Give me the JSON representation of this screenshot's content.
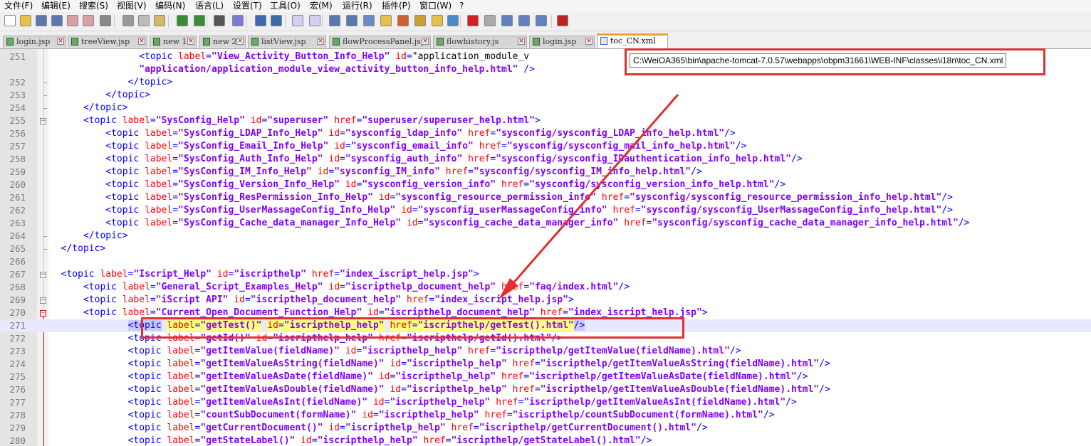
{
  "menu": [
    "文件(F)",
    "编辑(E)",
    "搜索(S)",
    "视图(V)",
    "编码(N)",
    "语言(L)",
    "设置(T)",
    "工具(O)",
    "宏(M)",
    "运行(R)",
    "插件(P)",
    "窗口(W)",
    "?"
  ],
  "tabs": [
    "login.jsp",
    "treeView.jsp",
    "new 1",
    "new 2",
    "listView.jsp",
    "flowProcessPanel.jsp",
    "flowhistory.js",
    "login.jsp",
    "toc_CN.xml"
  ],
  "tooltip": "C:\\WeiOA365\\bin\\apache-tomcat-7.0.57\\webapps\\obpm31661\\WEB-INF\\classes\\i18n\\toc_CN.xml",
  "toolbar_icons": [
    "new-file-icon",
    "open-icon",
    "save-icon",
    "save-all-icon",
    "close-icon",
    "close-all-icon",
    "print-icon",
    "cut-icon",
    "copy-icon",
    "paste-icon",
    "undo-icon",
    "redo-icon",
    "find-icon",
    "replace-icon",
    "zoom-in-icon",
    "zoom-out-icon",
    "sync-v-icon",
    "sync-h-icon",
    "word-wrap-icon",
    "show-all-chars-icon",
    "indent-guide-icon",
    "lang-icon",
    "doc-map-icon",
    "function-list-icon",
    "folder-icon",
    "monitor-icon",
    "record-macro-icon",
    "stop-macro-icon",
    "play-macro-icon",
    "run-macro-multiple-icon",
    "save-macro-icon",
    "spellcheck-icon"
  ],
  "lines": [
    {
      "n": "251",
      "code": "                <topic label=\"View_Activity_Button_Info_Help\" id=\"application_module_v"
    },
    {
      "n": "",
      "code": "                \"application/application_module_view_activity_button_info_help.html\" />"
    },
    {
      "n": "252",
      "code": "              </topic>"
    },
    {
      "n": "253",
      "code": "          </topic>"
    },
    {
      "n": "254",
      "code": "      </topic>"
    },
    {
      "n": "255",
      "code": "      <topic label=\"SysConfig_Help\" id=\"superuser\" href=\"superuser/superuser_help.html\">"
    },
    {
      "n": "256",
      "code": "          <topic label=\"SysConfig_LDAP_Info_Help\" id=\"sysconfig_ldap_info\" href=\"sysconfig/sysconfig_LDAP_info_help.html\"/>"
    },
    {
      "n": "257",
      "code": "          <topic label=\"SysConfig_Email_Info_Help\" id=\"sysconfig_email_info\" href=\"sysconfig/sysconfig_mail_info_help.html\"/>"
    },
    {
      "n": "258",
      "code": "          <topic label=\"SysConfig_Auth_Info_Help\" id=\"sysconfig_auth_info\" href=\"sysconfig/sysconfig_IDauthentication_info_help.html\"/>"
    },
    {
      "n": "259",
      "code": "          <topic label=\"SysConfig_IM_Info_Help\" id=\"sysconfig_IM_info\" href=\"sysconfig/sysconfig_IM_info_help.html\"/>"
    },
    {
      "n": "260",
      "code": "          <topic label=\"SysConfig_Version_Info_Help\" id=\"sysconfig_version_info\" href=\"sysconfig/sysconfig_version_info_help.html\"/>"
    },
    {
      "n": "261",
      "code": "          <topic label=\"SysConfig_ResPermission_Info_Help\" id=\"sysconfig_resource_permission_info\" href=\"sysconfig/sysconfig_resource_permission_info_help.html\"/>"
    },
    {
      "n": "262",
      "code": "          <topic label=\"SysConfig_UserMassageConfig_Info_Help\" id=\"sysconfig_userMassageConfig_info\" href=\"sysconfig/sysconfig_UserMassageConfig_info_help.html\"/>"
    },
    {
      "n": "263",
      "code": "          <topic label=\"SysConfig_Cache_data_manager_Info_Help\" id=\"sysconfig_cache_data_manager_info\" href=\"sysconfig/sysconfig_cache_data_manager_info_help.html\"/>"
    },
    {
      "n": "264",
      "code": "      </topic>"
    },
    {
      "n": "265",
      "code": "  </topic>"
    },
    {
      "n": "266",
      "code": ""
    },
    {
      "n": "267",
      "code": "  <topic label=\"Iscript_Help\" id=\"iscripthelp\" href=\"index_iscript_help.jsp\">"
    },
    {
      "n": "268",
      "code": "      <topic label=\"General_Script_Examples_Help\" id=\"iscripthelp_document_help\" href=\"faq/index.html\"/>"
    },
    {
      "n": "269",
      "code": "      <topic label=\"iScript API\" id=\"iscripthelp_document_help\" href=\"index_iscript_help.jsp\">"
    },
    {
      "n": "270",
      "code": "      <topic label=\"Current_Open_Document_Function_Help\" id=\"iscripthelp_document_help\" href=\"index_iscript_help.jsp\">"
    },
    {
      "n": "271",
      "code": "              <topic label=\"getTest()\" id=\"iscripthelp_help\" href=\"iscripthelp/getTest().html\"/>"
    },
    {
      "n": "272",
      "code": "              <topic label=\"getId()\" id=\"iscripthelp_help\" href=\"iscripthelp/getId().html\"/>"
    },
    {
      "n": "273",
      "code": "              <topic label=\"getItemValue(fieldName)\" id=\"iscripthelp_help\" href=\"iscripthelp/getItemValue(fieldName).html\"/>"
    },
    {
      "n": "274",
      "code": "              <topic label=\"getItemValueAsString(fieldName)\" id=\"iscripthelp_help\" href=\"iscripthelp/getItemValueAsString(fieldName).html\"/>"
    },
    {
      "n": "275",
      "code": "              <topic label=\"getItemValueAsDate(fieldName)\" id=\"iscripthelp_help\" href=\"iscripthelp/getItemValueAsDate(fieldName).html\"/>"
    },
    {
      "n": "276",
      "code": "              <topic label=\"getItemValueAsDouble(fieldName)\" id=\"iscripthelp_help\" href=\"iscripthelp/getItemValueAsDouble(fieldName).html\"/>"
    },
    {
      "n": "277",
      "code": "              <topic label=\"getItemValueAsInt(fieldName)\" id=\"iscripthelp_help\" href=\"iscripthelp/getItemValueAsInt(fieldName).html\"/>"
    },
    {
      "n": "278",
      "code": "              <topic label=\"countSubDocument(formName)\" id=\"iscripthelp_help\" href=\"iscripthelp/countSubDocument(formName).html\"/>"
    },
    {
      "n": "279",
      "code": "              <topic label=\"getCurrentDocument()\" id=\"iscripthelp_help\" href=\"iscripthelp/getCurrentDocument().html\"/>"
    },
    {
      "n": "280",
      "code": "              <topic label=\"getStateLabel()\" id=\"iscripthelp_help\" href=\"iscripthelp/getStateLabel().html\"/>"
    }
  ]
}
